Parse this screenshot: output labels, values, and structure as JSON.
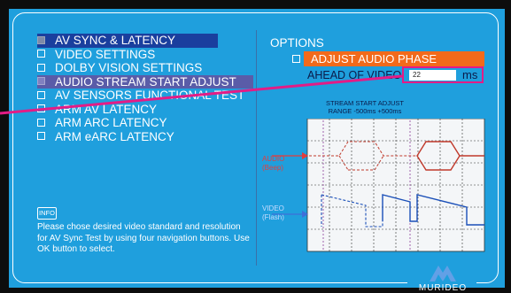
{
  "menu": {
    "items": [
      {
        "label": "AV SYNC & LATENCY",
        "state": "active"
      },
      {
        "label": "VIDEO SETTINGS",
        "state": ""
      },
      {
        "label": "DOLBY VISION SETTINGS",
        "state": ""
      },
      {
        "label": "AUDIO STREAM START ADJUST",
        "state": "highlight"
      },
      {
        "label": "AV SENSORS FUNCTIONAL TEST",
        "state": ""
      },
      {
        "label": "ARM AV LATENCY",
        "state": ""
      },
      {
        "label": "ARM ARC LATENCY",
        "state": ""
      },
      {
        "label": "ARM eARC LATENCY",
        "state": ""
      }
    ]
  },
  "info": {
    "badge": "INFO",
    "text": "Please chose desired video standard and resolution for AV Sync Test by using four navigation buttons. Use OK button to select."
  },
  "options": {
    "title": "OPTIONS",
    "phase_label": "ADJUST AUDIO PHASE",
    "ahead_label": "AHEAD OF VIDEO",
    "value": "22",
    "unit": "ms"
  },
  "diagram": {
    "title_line1": "STREAM START ADJUST",
    "title_line2": "RANGE -500ms +500ms",
    "audio_label": "AUDIO",
    "audio_sub": "(Beep)",
    "video_label": "VIDEO",
    "video_sub": "(Flash)"
  },
  "logo": {
    "text": "MURIDEO"
  },
  "colors": {
    "background": "#1f9fdd",
    "menu_active": "#1a3f9e",
    "menu_highlight": "#5a5ca8",
    "phase_bar": "#f26a1b",
    "pointer_line": "#e31c86",
    "audio_wave": "#c0392b",
    "video_wave": "#1a4fb8"
  }
}
